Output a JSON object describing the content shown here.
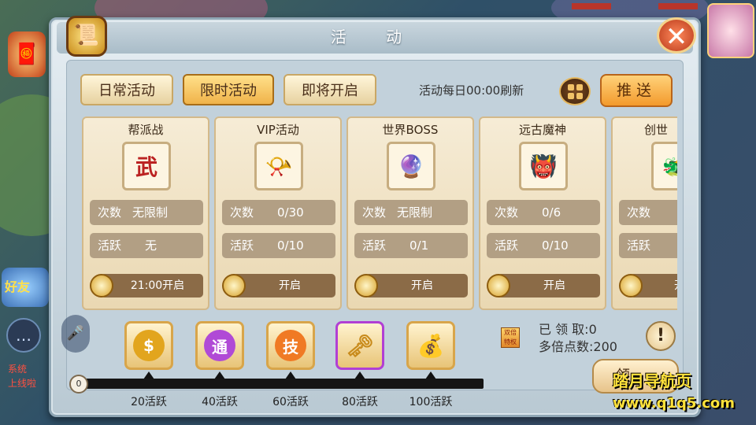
{
  "panel": {
    "title": "活 动",
    "close_icon": "close-icon",
    "tabs": [
      {
        "label": "日常活动",
        "active": false
      },
      {
        "label": "限时活动",
        "active": true
      },
      {
        "label": "即将开启",
        "active": false
      }
    ],
    "refresh_text": "活动每日00:00刷新",
    "push_label": "推送"
  },
  "cards": [
    {
      "title": "帮派战",
      "icon": "wu-emblem-icon",
      "glyph": "武",
      "count_label": "次数",
      "count_value": "无限制",
      "active_label": "活跃",
      "active_value": "无",
      "button": "21:00开启"
    },
    {
      "title": "VIP活动",
      "icon": "horn-icon",
      "glyph": "📯",
      "count_label": "次数",
      "count_value": "0/30",
      "active_label": "活跃",
      "active_value": "0/10",
      "button": "开启"
    },
    {
      "title": "世界BOSS",
      "icon": "boss-orb-icon",
      "glyph": "🔮",
      "count_label": "次数",
      "count_value": "无限制",
      "active_label": "活跃",
      "active_value": "0/1",
      "button": "开启"
    },
    {
      "title": "远古魔神",
      "icon": "demon-god-icon",
      "glyph": "👹",
      "count_label": "次数",
      "count_value": "0/6",
      "active_label": "活跃",
      "active_value": "0/10",
      "button": "开启"
    },
    {
      "title": "创世",
      "icon": "creation-icon",
      "glyph": "🐲",
      "count_label": "次数",
      "count_value": "",
      "active_label": "活跃",
      "active_value": "",
      "button": "开"
    }
  ],
  "rewards": [
    {
      "milestone": "20活跃",
      "icon": "gold-coin-bag-icon",
      "glyph": "$",
      "color": "#e2a51e"
    },
    {
      "milestone": "40活跃",
      "icon": "tong-orb-icon",
      "glyph": "通",
      "color": "#b04ad6"
    },
    {
      "milestone": "60活跃",
      "icon": "ji-skill-icon",
      "glyph": "技",
      "color": "#f07a24"
    },
    {
      "milestone": "80活跃",
      "icon": "golden-key-icon",
      "glyph": "🗝",
      "color": "#d8a23a"
    },
    {
      "milestone": "100活跃",
      "icon": "treasure-bag-icon",
      "glyph": "💰",
      "color": "#d8a23a"
    }
  ],
  "progress": {
    "current": "0",
    "fraction": 0
  },
  "claim": {
    "claimed_label": "已 领 取:0",
    "multiplier_label": "多倍点数:200",
    "button_label": "领",
    "info_icon": "exclamation-icon",
    "bonus_text": "双倍 特权"
  },
  "hud": {
    "sys_line1": "系统",
    "sys_line2": "上线啦",
    "friend_label": "好友"
  },
  "watermark": {
    "line1": "踏月导航页",
    "line2": "www.q1q5.com"
  }
}
